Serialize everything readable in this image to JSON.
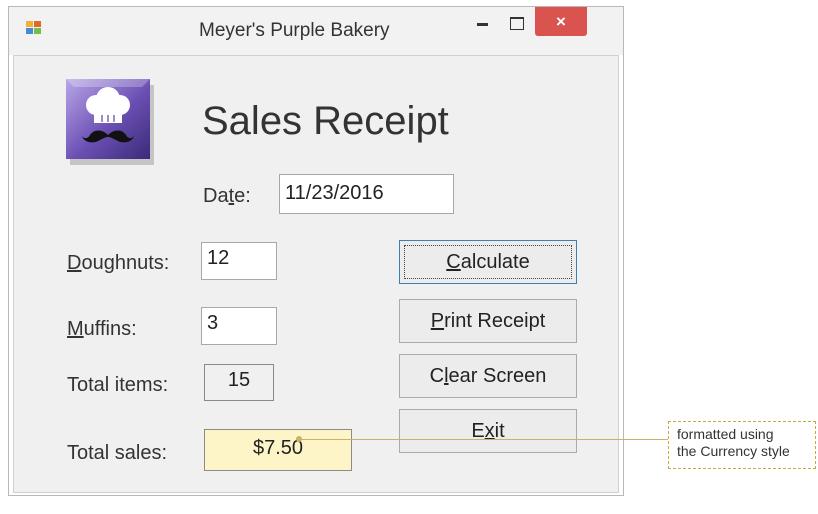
{
  "window": {
    "title": "Meyer's Purple Bakery",
    "close_symbol": "×"
  },
  "form": {
    "heading": "Sales Receipt",
    "date_label_pre": "Da",
    "date_label_key": "t",
    "date_label_post": "e:",
    "date_value": "11/23/2016",
    "doughnuts_label_key": "D",
    "doughnuts_label_rest": "oughnuts:",
    "doughnuts_value": "12",
    "muffins_label_key": "M",
    "muffins_label_rest": "uffins:",
    "muffins_value": "3",
    "total_items_label": "Total items:",
    "total_items_value": "15",
    "total_sales_label": "Total sales:",
    "total_sales_value": "$7.50"
  },
  "buttons": {
    "calculate_key": "C",
    "calculate_rest": "alculate",
    "print_key": "P",
    "print_rest": "rint Receipt",
    "clear_pre": "C",
    "clear_key": "l",
    "clear_rest": "ear Screen",
    "exit_pre": "E",
    "exit_key": "x",
    "exit_rest": "it"
  },
  "annotation": {
    "line1": "formatted using",
    "line2": "the Currency style"
  },
  "colors": {
    "total_sales_bg": "#fdf5c8",
    "close_button": "#d9534f",
    "callout_border": "#c9a93a"
  },
  "icons": {
    "app": "form-icon",
    "logo": "chef-hat-mustache-icon"
  }
}
